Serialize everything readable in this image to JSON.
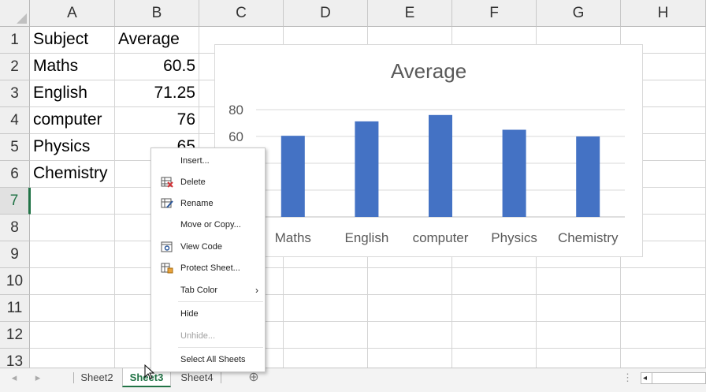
{
  "columns": [
    "A",
    "B",
    "C",
    "D",
    "E",
    "F",
    "G",
    "H"
  ],
  "rows": [
    "1",
    "2",
    "3",
    "4",
    "5",
    "6",
    "7",
    "8",
    "9",
    "10",
    "11",
    "12",
    "13"
  ],
  "table": [
    [
      "Subject",
      "Average"
    ],
    [
      "Maths",
      "60.5"
    ],
    [
      "English",
      "71.25"
    ],
    [
      "computer",
      "76"
    ],
    [
      "Physics",
      "65"
    ],
    [
      "Chemistry",
      ""
    ]
  ],
  "chart_data": {
    "type": "bar",
    "title": "Average",
    "categories": [
      "Maths",
      "English",
      "computer",
      "Physics",
      "Chemistry"
    ],
    "values": [
      60.5,
      71.25,
      76,
      65,
      60
    ],
    "ylim": [
      0,
      80
    ],
    "yticks": [
      "80",
      "60"
    ],
    "grid": true,
    "bar_color": "#4472c4"
  },
  "context_menu": {
    "items": [
      {
        "label": "Insert...",
        "icon": "insert",
        "enabled": true
      },
      {
        "label": "Delete",
        "icon": "delete-sheet-icon",
        "enabled": true
      },
      {
        "label": "Rename",
        "icon": "rename-icon",
        "enabled": true
      },
      {
        "label": "Move or Copy...",
        "icon": "",
        "enabled": true
      },
      {
        "label": "View Code",
        "icon": "view-code-icon",
        "enabled": true
      },
      {
        "label": "Protect Sheet...",
        "icon": "protect-sheet-icon",
        "enabled": true
      },
      {
        "label": "Tab Color",
        "icon": "",
        "enabled": true,
        "submenu": "›"
      },
      {
        "label": "Hide",
        "icon": "",
        "enabled": true
      },
      {
        "label": "Unhide...",
        "icon": "",
        "enabled": false
      },
      {
        "label": "Select All Sheets",
        "icon": "",
        "enabled": true
      }
    ]
  },
  "tabs": {
    "sheet2": "Sheet2",
    "sheet3": "Sheet3",
    "sheet4": "Sheet4",
    "add": "⊕",
    "prev": "◂",
    "next": "▸"
  },
  "colors": {
    "accent": "#217346",
    "bar": "#4472c4"
  }
}
